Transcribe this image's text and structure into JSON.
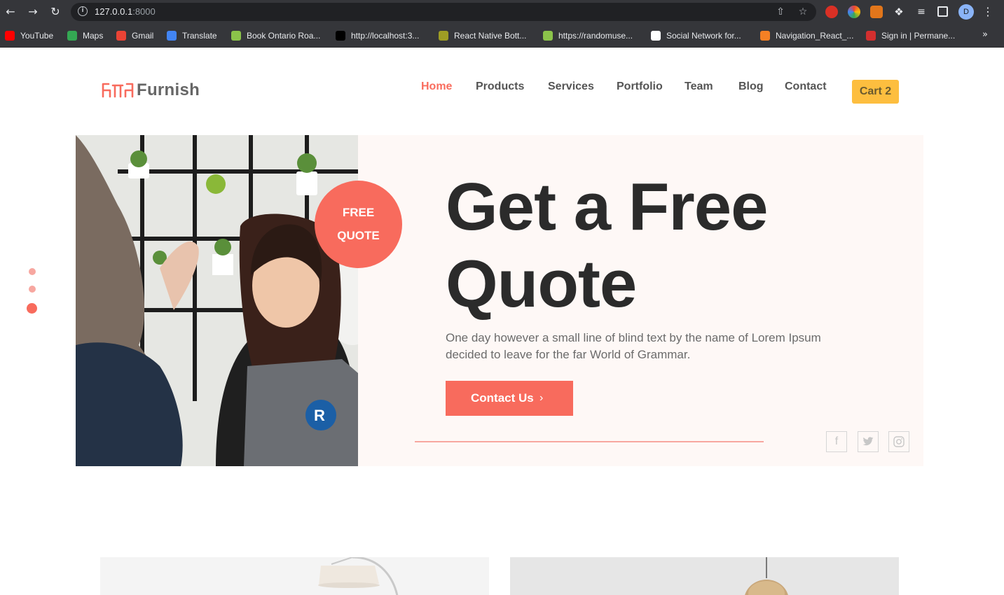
{
  "browser": {
    "url_host": "127.0.0.1",
    "url_port": ":8000",
    "profile_initial": "D",
    "bookmarks": [
      {
        "label": "YouTube",
        "color": "#ff0000"
      },
      {
        "label": "Maps",
        "color": "#34a853"
      },
      {
        "label": "Gmail",
        "color": "#ea4335"
      },
      {
        "label": "Translate",
        "color": "#4285f4"
      },
      {
        "label": "Book Ontario Roa...",
        "color": "#8bc34a"
      },
      {
        "label": "http://localhost:3...",
        "color": "#000000"
      },
      {
        "label": "React Native Bott...",
        "color": "#9e9d24"
      },
      {
        "label": "https://randomuse...",
        "color": "#8bc34a"
      },
      {
        "label": "Social Network for...",
        "color": "#ffffff"
      },
      {
        "label": "Navigation_React_...",
        "color": "#f48024"
      },
      {
        "label": "Sign in | Permane...",
        "color": "#d32f2f"
      }
    ],
    "more": "»"
  },
  "site": {
    "logo_text": "Furnish",
    "nav": [
      {
        "label": "Home",
        "active": true
      },
      {
        "label": "Products",
        "active": false
      },
      {
        "label": "Services",
        "active": false
      },
      {
        "label": "Portfolio",
        "active": false
      },
      {
        "label": "Team",
        "active": false
      },
      {
        "label": "Blog",
        "active": false
      },
      {
        "label": "Contact",
        "active": false
      }
    ],
    "cart_label": "Cart 2",
    "accent_color": "#f86b5d",
    "cart_color": "#fdbe3f"
  },
  "hero": {
    "badge_line1": "FREE",
    "badge_line2": "QUOTE",
    "headline_word1": "Get",
    "headline_word2": "a Free",
    "headline_word3": "Quote",
    "description": "One day however a small line of blind text by the name of Lorem Ipsum decided to leave for the far World of Grammar.",
    "cta_label": "Contact Us",
    "cta_icon": "chevron-right-icon",
    "social": [
      "facebook-icon",
      "twitter-icon",
      "instagram-icon"
    ],
    "slides_total": 3,
    "slide_active": 3
  }
}
